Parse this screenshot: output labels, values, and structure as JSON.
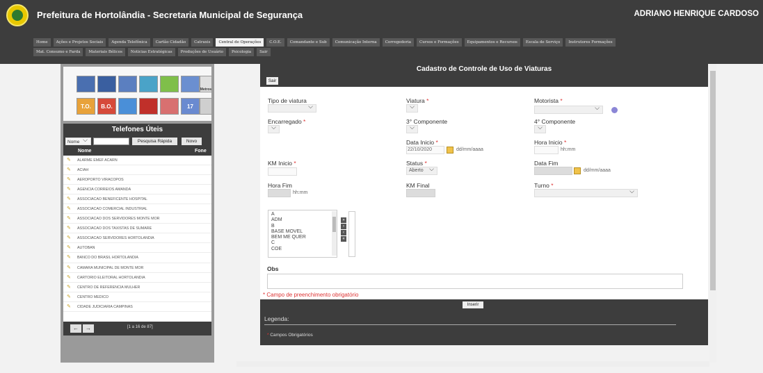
{
  "header": {
    "title": "Prefeitura de Hortolândia - Secretaria Municipal de Segurança",
    "user": "ADRIANO HENRIQUE CARDOSO"
  },
  "nav": {
    "row1": [
      "Home",
      "Ações e Projetos Sociais",
      "Agenda Telefônica",
      "Cartão Cidadão",
      "Catraxis",
      "Central de Operações",
      "C.O.E.",
      "Comandante e Sub",
      "Comunicação Interna",
      "Corregedoria",
      "Cursos e Formações",
      "Equipamentos e Recursos",
      "Escala de Serviço",
      "Instrutores Formações"
    ],
    "row2": [
      "Mat. Consumo e Farda",
      "Materiais Bélicos",
      "Noticias Estratégicas",
      "Produções de Usuário",
      "Psicologia",
      "Sair"
    ]
  },
  "phones": {
    "title": "Telefones Úteis",
    "filter_value": "Nome",
    "quick_search_label": "Pesquisa Rápida",
    "new_label": "Novo",
    "col_name": "Nome",
    "col_phone": "Fone",
    "rows": [
      "ALARME EMEF ACARN",
      "ACIAH",
      "AEROPORTO VIRACOPOS",
      "AGENCIA CORREIOS AMANDA",
      "ASSOCIACAO BENEFICENTE HOSPITAL",
      "ASSOCIACAO COMERCIAL INDUSTRIAL",
      "ASSOCIACAO DOS SERVIDORES MONTE MOR",
      "ASSOCIACAO DOS TAXISTAS DE SUMARE",
      "ASSOCIACAO SERVIDORES HORTOLANDIA",
      "AUTOBAN",
      "BANCO DO BRASIL HORTOLANDIA",
      "CAMARA MUNICIPAL DE MONTE MOR",
      "CARTORIO ELEITORAL HORTOLANDIA",
      "CENTRO DE REFERENCIA MULHER",
      "CENTRO MEDICO",
      "CIDADE JUDICIARIA CAMPINAS"
    ],
    "pager_info": "[1 a 16 de 87]"
  },
  "icons": [
    {
      "name": "user-icon",
      "color": "#4a6fb0"
    },
    {
      "name": "fuel-icon",
      "color": "#3a5fa0"
    },
    {
      "name": "vehicle-icon",
      "color": "#5b7fc0"
    },
    {
      "name": "building-icon",
      "color": "#4aa3c8"
    },
    {
      "name": "map-icon",
      "color": "#7fbf4a"
    },
    {
      "name": "search-icon",
      "color": "#6b8fd0"
    },
    {
      "name": "officer-icon",
      "color": "#e0e0e0"
    },
    {
      "name": "to-icon",
      "color": "#e8a23a"
    },
    {
      "name": "bo-icon",
      "color": "#d64a3a"
    },
    {
      "name": "email-icon",
      "color": "#4a8fd8"
    },
    {
      "name": "person-icon",
      "color": "#c0302a"
    },
    {
      "name": "chart-icon",
      "color": "#d87070"
    },
    {
      "name": "calendar-icon",
      "color": "#6a8ad0"
    },
    {
      "name": "tools-icon",
      "color": "#cfcfcf"
    }
  ],
  "icon_texts": {
    "metros": "Metros",
    "to": "T.O.",
    "bo": "B.O.",
    "day": "17"
  },
  "form": {
    "title": "Cadastro de Controle de Uso de Viaturas",
    "exit_label": "Sair",
    "tipo_viatura": "Tipo de viatura",
    "viatura": "Viatura",
    "motorista": "Motorista",
    "encarregado": "Encarregado",
    "componente3": "3° Componente",
    "componente4": "4° Componente",
    "data_inicio": "Data Inicio",
    "data_inicio_value": "22/10/2020",
    "date_format": "dd/mm/aaaa",
    "hora_inicio": "Hora Inicio",
    "time_format": "hh:mm",
    "km_inicio": "KM Inicio",
    "status": "Status",
    "status_value": "Aberto",
    "data_fim": "Data Fim",
    "hora_fim": "Hora Fim",
    "km_final": "KM Final",
    "turno": "Turno",
    "required_mark": "*",
    "list_options": [
      "A",
      "ADM",
      "B",
      "BASE MOVEL",
      "BEM ME QUER",
      "C",
      "COE"
    ],
    "move_buttons": [
      "»",
      "›",
      "‹",
      "«"
    ],
    "obs_label": "Obs",
    "required_note": "* Campo de preenchimento obrigatório",
    "insert_label": "Inserir",
    "legend_title": "Legenda:",
    "legend_item": "Campos Obrigatórios",
    "legend_dot": "*"
  }
}
